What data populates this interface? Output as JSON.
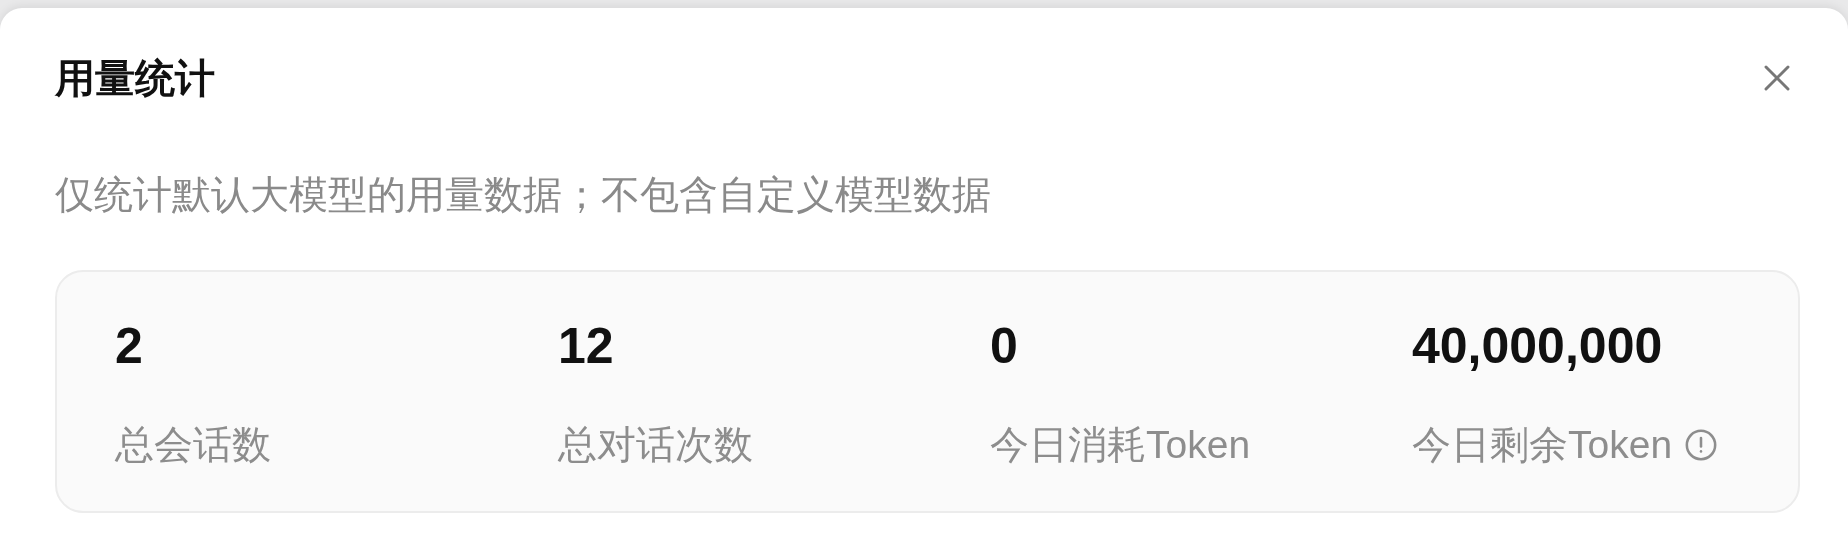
{
  "dialog": {
    "title": "用量统计",
    "subtitle": "仅统计默认大模型的用量数据；不包含自定义模型数据"
  },
  "stats": [
    {
      "value": "2",
      "label": "总会话数",
      "info": false
    },
    {
      "value": "12",
      "label": "总对话次数",
      "info": false
    },
    {
      "value": "0",
      "label": "今日消耗Token",
      "info": false
    },
    {
      "value": "40,000,000",
      "label": "今日剩余Token",
      "info": true
    }
  ]
}
